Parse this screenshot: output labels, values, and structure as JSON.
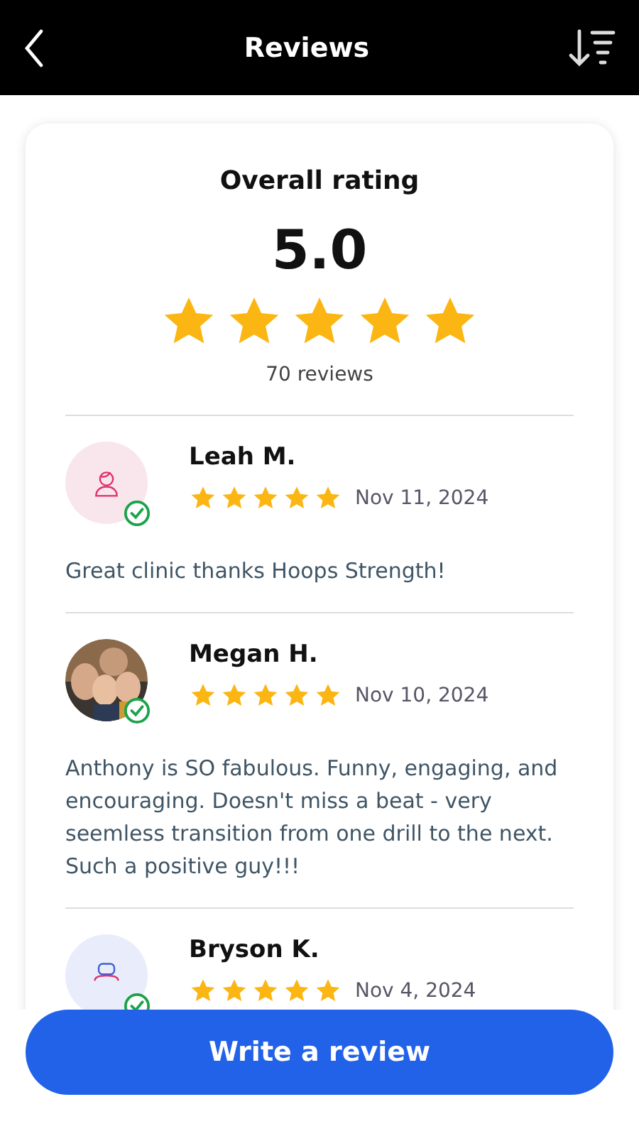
{
  "header": {
    "title": "Reviews"
  },
  "summary": {
    "heading": "Overall rating",
    "score": "5.0",
    "stars": 5,
    "count": "70 reviews"
  },
  "reviews": [
    {
      "name": "Leah M.",
      "kind": "female",
      "verified": true,
      "stars": 5,
      "date": "Nov 11, 2024",
      "text": "Great clinic thanks Hoops Strength!"
    },
    {
      "name": "Megan H.",
      "kind": "picture",
      "verified": true,
      "stars": 5,
      "date": "Nov 10, 2024",
      "text": "Anthony is SO fabulous. Funny, engaging, and encouraging. Doesn't miss a beat - very seemless transition from one drill to the next. Such a positive guy!!!"
    },
    {
      "name": "Bryson K.",
      "kind": "male",
      "verified": true,
      "stars": 5,
      "date": "Nov 4, 2024"
    }
  ],
  "action": {
    "label": "Write a review"
  }
}
